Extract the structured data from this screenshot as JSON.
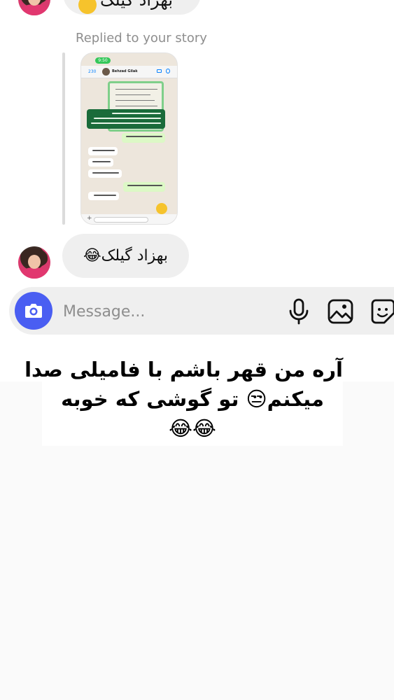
{
  "top_message": {
    "text": "بهزاد گیلک"
  },
  "story_reply": {
    "label": "Replied to your story",
    "story": {
      "status_time": "9:50",
      "back_count": "230",
      "contact_name": "Behzad Gilak"
    }
  },
  "bottom_message": {
    "text": "بهزاد گیلک😂"
  },
  "composer": {
    "placeholder": "Message...",
    "camera_icon": "camera-icon",
    "mic_icon": "microphone-icon",
    "gallery_icon": "image-icon",
    "sticker_icon": "sticker-icon"
  },
  "caption": {
    "line1": "آره من قهر باشم با فامیلی صدا",
    "line2": "میکنم😒 تو گوشی که خوبه",
    "line3": "😂😂"
  },
  "colors": {
    "accent": "#4a5ef2",
    "bubble": "#efefef",
    "secondary_text": "#8e8e8e"
  }
}
